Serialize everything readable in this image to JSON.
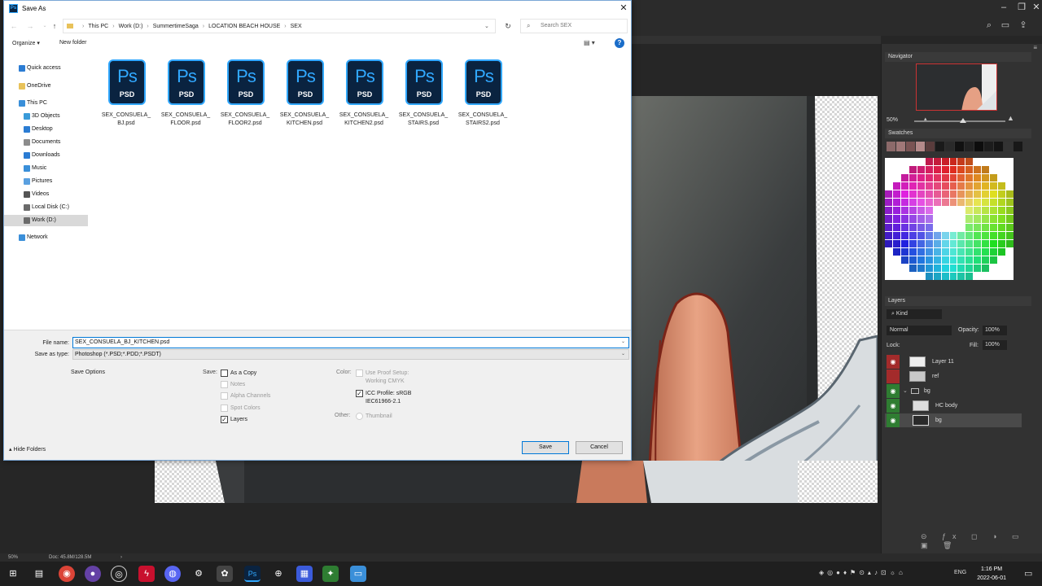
{
  "dialog": {
    "title": "Save As",
    "title_icon": "Ps",
    "close": "✕",
    "breadcrumb": [
      "This PC",
      "Work (D:)",
      "SummertimeSaga",
      "LOCATION BEACH HOUSE",
      "SEX"
    ],
    "search_placeholder": "Search SEX",
    "organize": "Organize ▾",
    "new_folder": "New folder",
    "help": "?",
    "nav": [
      {
        "label": "Quick access",
        "icon": "star-icon",
        "color": "#2b7cd3"
      },
      {
        "label": "OneDrive",
        "icon": "cloud-icon",
        "color": "#e8c25a"
      },
      {
        "label": "This PC",
        "icon": "computer-icon",
        "color": "#3a8fd9"
      },
      {
        "label": "3D Objects",
        "icon": "cube-icon",
        "color": "#3a9bd9"
      },
      {
        "label": "Desktop",
        "icon": "desktop-icon",
        "color": "#2b7cd3"
      },
      {
        "label": "Documents",
        "icon": "document-icon",
        "color": "#8c8c8c"
      },
      {
        "label": "Downloads",
        "icon": "download-icon",
        "color": "#2b7cd3"
      },
      {
        "label": "Music",
        "icon": "music-icon",
        "color": "#3a8fd9"
      },
      {
        "label": "Pictures",
        "icon": "picture-icon",
        "color": "#5aa0e0"
      },
      {
        "label": "Videos",
        "icon": "video-icon",
        "color": "#555555"
      },
      {
        "label": "Local Disk (C:)",
        "icon": "drive-icon",
        "color": "#6a6a6a"
      },
      {
        "label": "Work (D:)",
        "icon": "drive-icon",
        "color": "#6a6a6a"
      },
      {
        "label": "Network",
        "icon": "network-icon",
        "color": "#3a8fd9"
      }
    ],
    "files": [
      {
        "line1": "SEX_CONSUELA_",
        "line2": "BJ.psd"
      },
      {
        "line1": "SEX_CONSUELA_",
        "line2": "FLOOR.psd"
      },
      {
        "line1": "SEX_CONSUELA_",
        "line2": "FLOOR2.psd"
      },
      {
        "line1": "SEX_CONSUELA_",
        "line2": "KITCHEN.psd"
      },
      {
        "line1": "SEX_CONSUELA_",
        "line2": "KITCHEN2.psd"
      },
      {
        "line1": "SEX_CONSUELA_",
        "line2": "STAIRS.psd"
      },
      {
        "line1": "SEX_CONSUELA_",
        "line2": "STAIRS2.psd"
      }
    ],
    "psd_icon": {
      "ps": "Ps",
      "psd": "PSD"
    },
    "file_name_label": "File name:",
    "file_name_value": "SEX_CONSUELA_BJ_KITCHEN.psd",
    "save_type_label": "Save as type:",
    "save_type_value": "Photoshop (*.PSD;*.PDD;*.PSDT)",
    "save_options_title": "Save Options",
    "save_label": "Save:",
    "options": {
      "as_copy": {
        "label": "As a Copy",
        "checked": false,
        "enabled": true
      },
      "notes": {
        "label": "Notes",
        "checked": false,
        "enabled": false
      },
      "alpha": {
        "label": "Alpha Channels",
        "checked": false,
        "enabled": false
      },
      "spot": {
        "label": "Spot Colors",
        "checked": false,
        "enabled": false
      },
      "layers": {
        "label": "Layers",
        "checked": true,
        "enabled": true
      }
    },
    "color_label": "Color:",
    "proof_line1": "Use Proof Setup:",
    "proof_line2": "Working CMYK",
    "icc_line1": "ICC Profile: sRGB",
    "icc_line2": "IEC61966-2.1",
    "other_label": "Other:",
    "thumbnail": "Thumbnail",
    "hide_folders": "Hide Folders",
    "save_button": "Save",
    "cancel_button": "Cancel"
  },
  "photoshop": {
    "navigator_title": "Navigator",
    "navigator_zoom": "50%",
    "swatches_title": "Swatches",
    "layers_title": "Layers",
    "kind_filter": "Kind",
    "blend_mode": "Normal",
    "opacity_label": "Opacity:",
    "opacity_value": "100%",
    "lock_label": "Lock:",
    "fill_label": "Fill:",
    "fill_value": "100%",
    "layers": [
      "Layer 11",
      "ref",
      "bg",
      "HC body",
      "bg"
    ],
    "status_zoom": "50%",
    "status_doc": "Doc: 45.8M/128.5M",
    "accent_color": "#31a8ff"
  },
  "taskbar": {
    "language": "ENG",
    "time": "1:16 PM",
    "date": "2022-06-01"
  }
}
